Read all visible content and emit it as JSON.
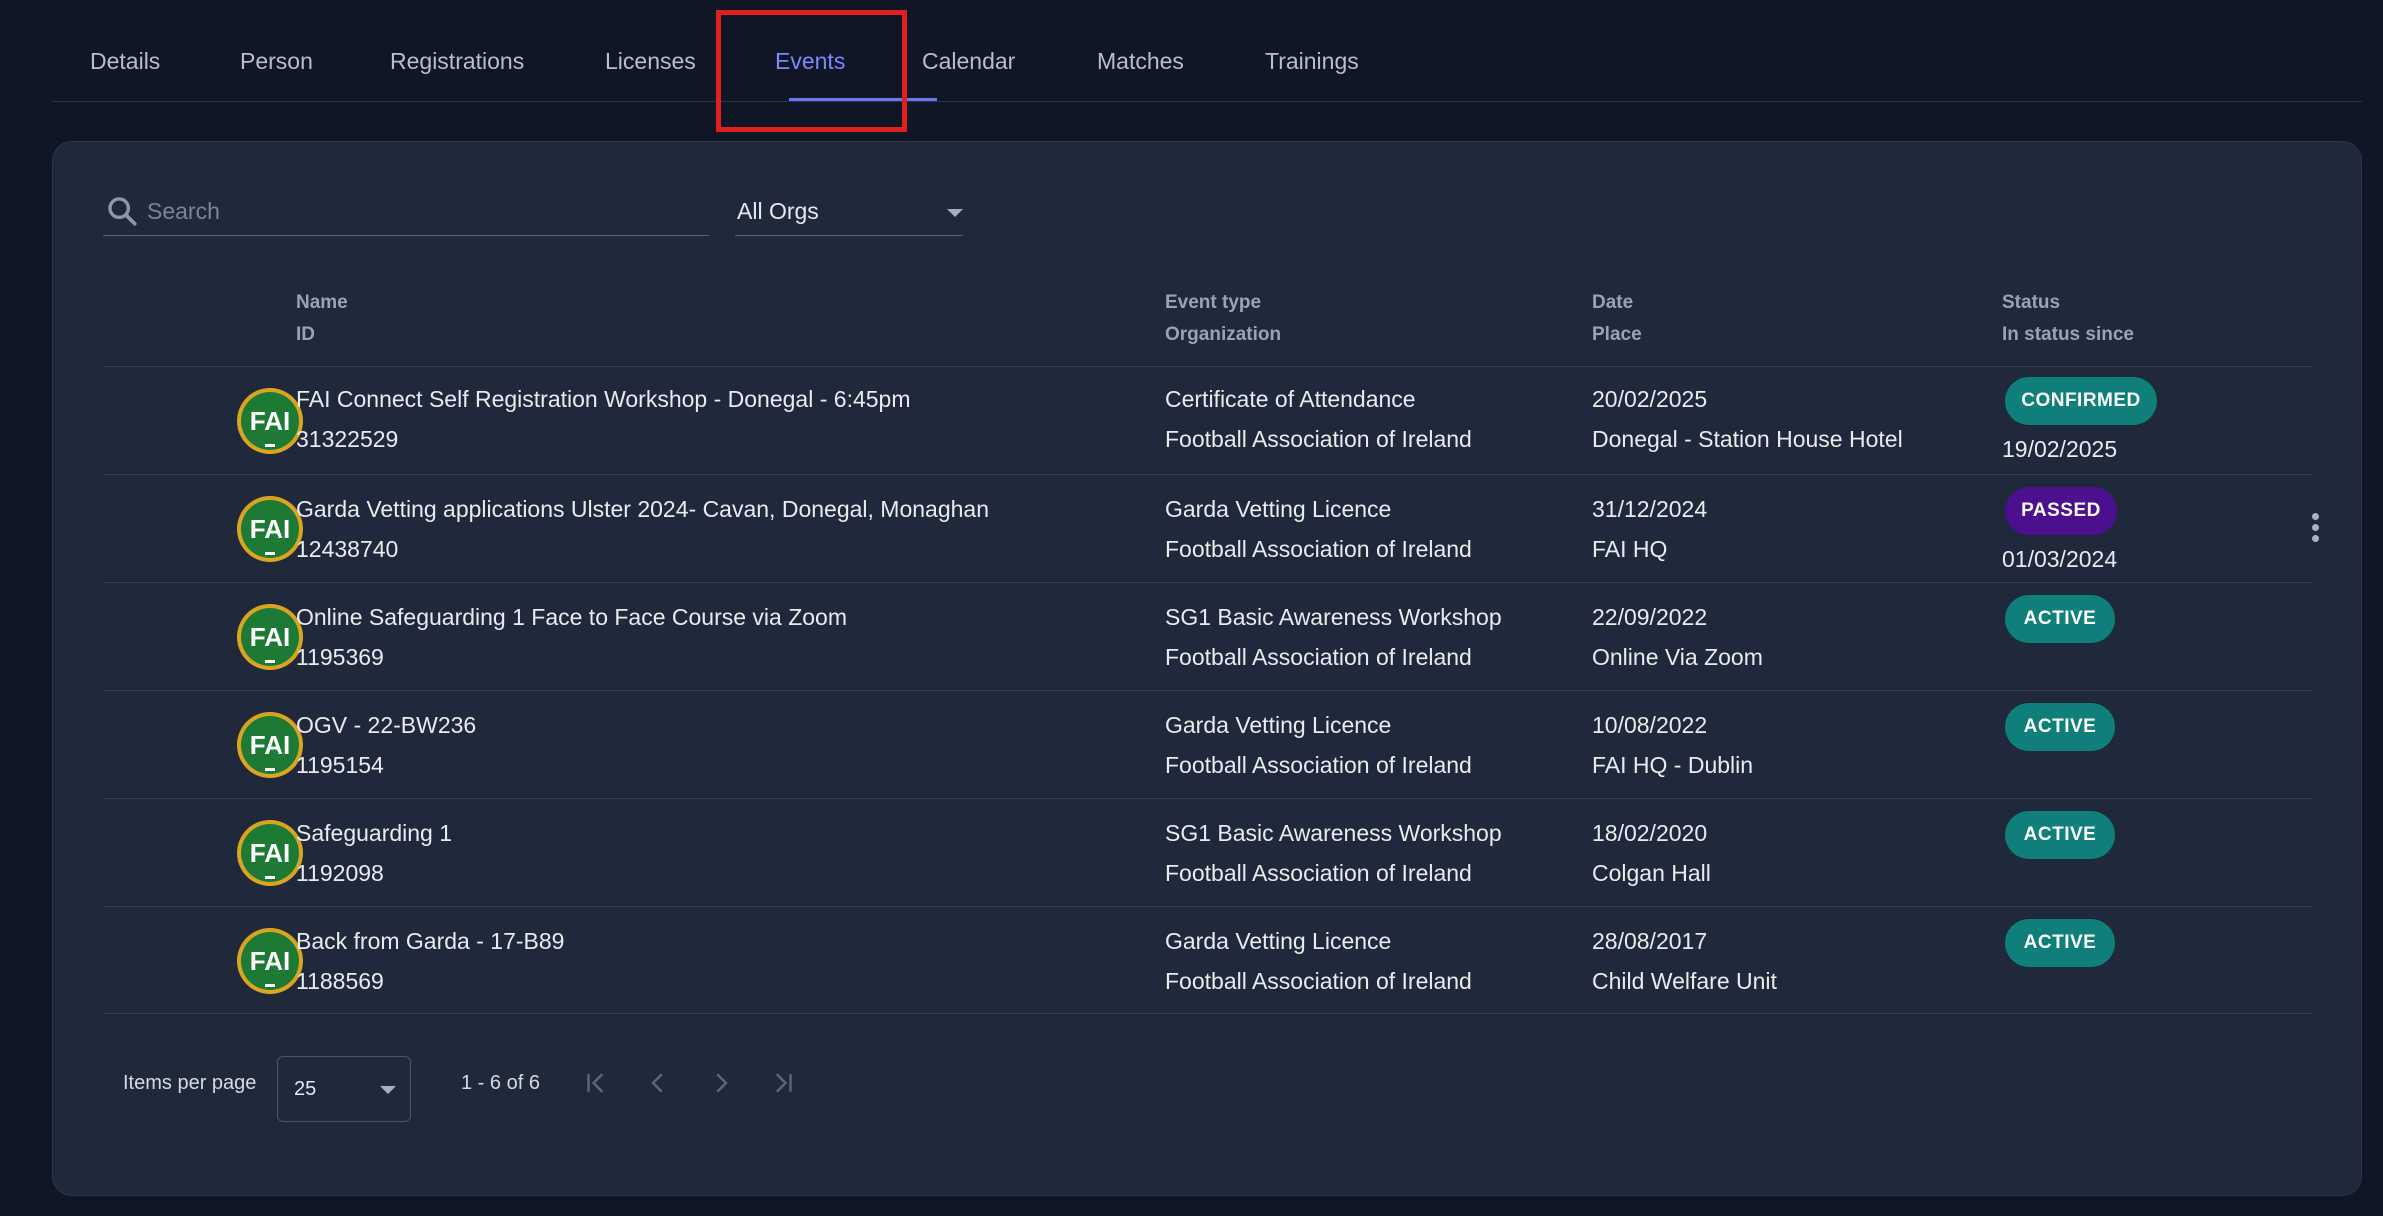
{
  "tabs": [
    {
      "label": "Details"
    },
    {
      "label": "Person"
    },
    {
      "label": "Registrations"
    },
    {
      "label": "Licenses"
    },
    {
      "label": "Events"
    },
    {
      "label": "Calendar"
    },
    {
      "label": "Matches"
    },
    {
      "label": "Trainings"
    }
  ],
  "active_tab": "Events",
  "search": {
    "placeholder": "Search",
    "value": ""
  },
  "org_filter": {
    "value": "All Orgs"
  },
  "table": {
    "headers": {
      "name": "Name",
      "id": "ID",
      "event_type": "Event type",
      "organization": "Organization",
      "date": "Date",
      "place": "Place",
      "status": "Status",
      "status_since": "In status since"
    },
    "rows": [
      {
        "name": "FAI Connect Self Registration Workshop - Donegal - 6:45pm",
        "id": "31322529",
        "event_type": "Certificate of Attendance",
        "organization": "Football Association of Ireland",
        "date": "20/02/2025",
        "place": "Donegal - Station House Hotel",
        "status": "CONFIRMED",
        "status_since": "19/02/2025"
      },
      {
        "name": "Garda Vetting applications Ulster 2024- Cavan, Donegal, Monaghan",
        "id": "12438740",
        "event_type": "Garda Vetting Licence",
        "organization": "Football Association of Ireland",
        "date": "31/12/2024",
        "place": "FAI HQ",
        "status": "PASSED",
        "status_since": "01/03/2024"
      },
      {
        "name": "Online Safeguarding 1 Face to Face Course via Zoom",
        "id": "1195369",
        "event_type": "SG1 Basic Awareness Workshop",
        "organization": "Football Association of Ireland",
        "date": "22/09/2022",
        "place": "Online Via Zoom",
        "status": "ACTIVE",
        "status_since": ""
      },
      {
        "name": "OGV - 22-BW236",
        "id": "1195154",
        "event_type": "Garda Vetting Licence",
        "organization": "Football Association of Ireland",
        "date": "10/08/2022",
        "place": "FAI HQ - Dublin",
        "status": "ACTIVE",
        "status_since": ""
      },
      {
        "name": "Safeguarding 1",
        "id": "1192098",
        "event_type": "SG1 Basic Awareness Workshop",
        "organization": "Football Association of Ireland",
        "date": "18/02/2020",
        "place": "Colgan Hall",
        "status": "ACTIVE",
        "status_since": ""
      },
      {
        "name": "Back from Garda - 17-B89",
        "id": "1188569",
        "event_type": "Garda Vetting Licence",
        "organization": "Football Association of Ireland",
        "date": "28/08/2017",
        "place": "Child Welfare Unit",
        "status": "ACTIVE",
        "status_since": ""
      }
    ]
  },
  "logo_text": "FAI",
  "pagination": {
    "items_per_page_label": "Items per page",
    "items_per_page": "25",
    "range": "1 - 6 of 6"
  },
  "colors": {
    "confirmed": "#0f7f7a",
    "passed": "#4b0f8f",
    "active": "#0f7f7a",
    "accent": "#7f86ff",
    "highlight": "#e0201e"
  },
  "icons": {
    "search": "search-icon",
    "first_page": "first-page-icon",
    "prev_page": "chevron-left-icon",
    "next_page": "chevron-right-icon",
    "last_page": "last-page-icon",
    "more": "more-vertical-icon"
  }
}
